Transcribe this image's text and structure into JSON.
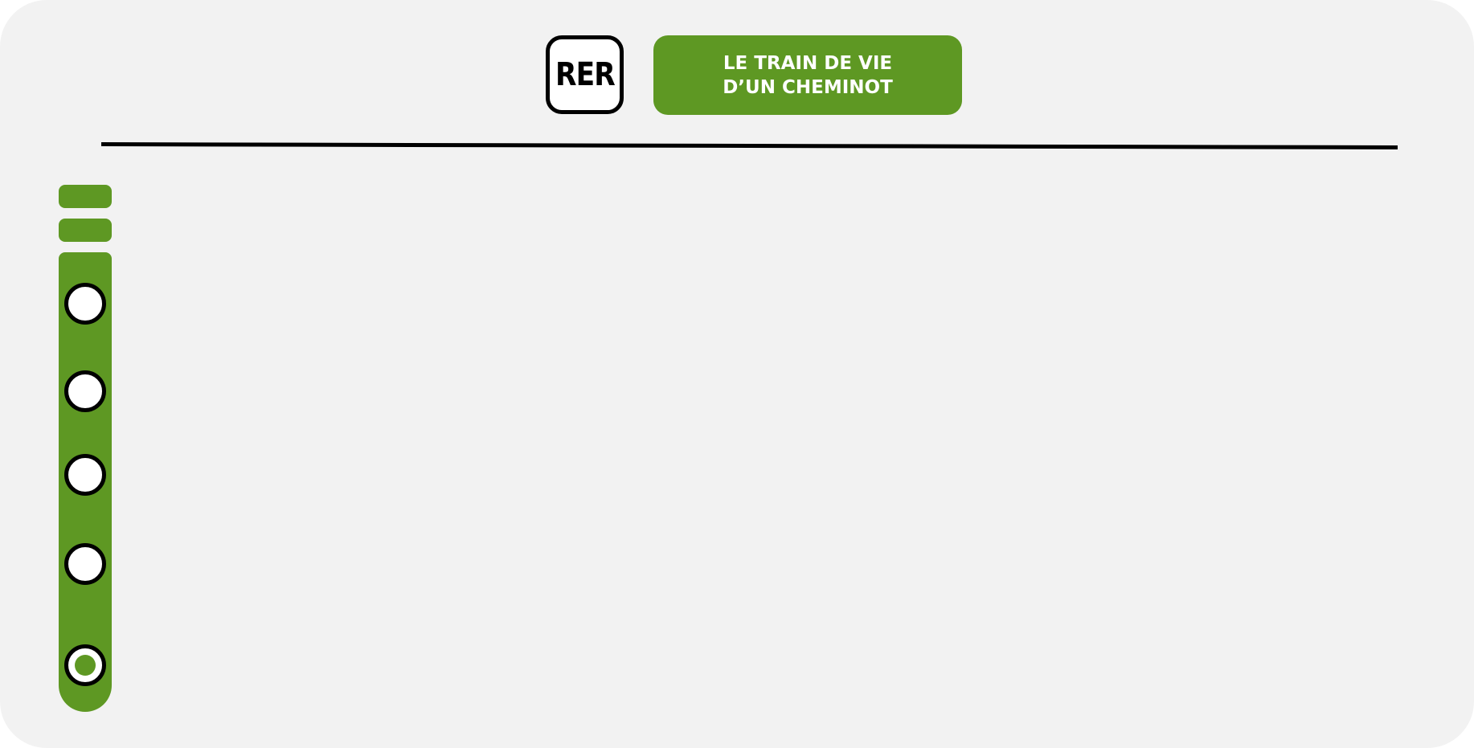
{
  "header": {
    "logo_text": "RER",
    "title": "LE TRAIN DE VIE\nD’UN CHEMINOT"
  },
  "line": {
    "color": "#5e9823",
    "stops": [
      {
        "type": "station"
      },
      {
        "type": "station"
      },
      {
        "type": "station"
      },
      {
        "type": "station"
      },
      {
        "type": "terminus"
      }
    ]
  },
  "colors": {
    "background": "#f2f2f2",
    "accent": "#5e9823",
    "ink": "#000000",
    "badge_text": "#ffffff"
  }
}
